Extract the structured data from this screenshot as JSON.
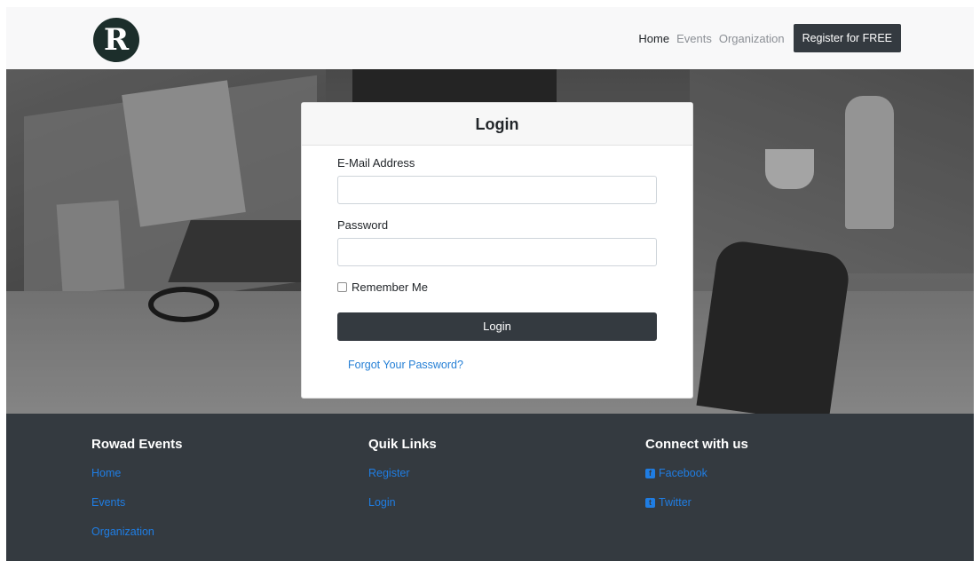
{
  "navbar": {
    "logo_letter": "R",
    "links": [
      {
        "label": "Home"
      },
      {
        "label": "Events"
      },
      {
        "label": "Organization"
      }
    ],
    "cta_label": "Register for FREE"
  },
  "login": {
    "title": "Login",
    "email_label": "E-Mail Address",
    "email_value": "",
    "password_label": "Password",
    "password_value": "",
    "remember_label": "Remember Me",
    "remember_checked": false,
    "submit_label": "Login",
    "forgot_label": "Forgot Your Password?"
  },
  "footer": {
    "col1": {
      "title": "Rowad Events",
      "links": [
        {
          "label": "Home"
        },
        {
          "label": "Events"
        },
        {
          "label": "Organization"
        }
      ]
    },
    "col2": {
      "title": "Quik Links",
      "links": [
        {
          "label": "Register"
        },
        {
          "label": "Login"
        }
      ]
    },
    "col3": {
      "title": "Connect with us",
      "links": [
        {
          "label": "Facebook",
          "icon": "facebook-icon"
        },
        {
          "label": "Twitter",
          "icon": "twitter-icon"
        }
      ]
    }
  },
  "colors": {
    "navbar_bg": "#f8f8f9",
    "dark": "#343a40",
    "link_blue": "#1f7de3"
  }
}
